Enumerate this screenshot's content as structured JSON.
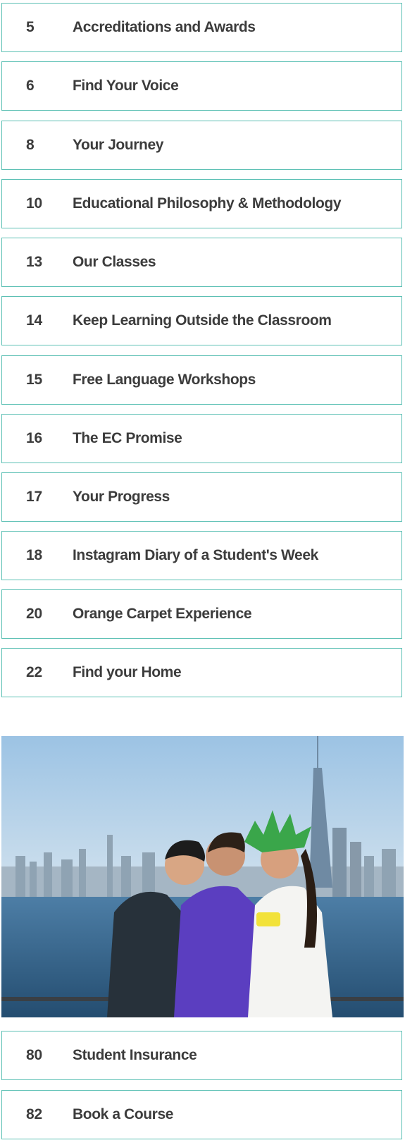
{
  "toc_top": [
    {
      "page": "5",
      "title": "Accreditations and Awards"
    },
    {
      "page": "6",
      "title": "Find Your Voice"
    },
    {
      "page": "8",
      "title": "Your Journey"
    },
    {
      "page": "10",
      "title": "Educational Philosophy & Methodology"
    },
    {
      "page": "13",
      "title": "Our Classes"
    },
    {
      "page": "14",
      "title": "Keep Learning Outside the Classroom"
    },
    {
      "page": "15",
      "title": "Free Language Workshops"
    },
    {
      "page": "16",
      "title": "The EC Promise"
    },
    {
      "page": "17",
      "title": "Your Progress"
    },
    {
      "page": "18",
      "title": "Instagram Diary of a Student's Week"
    },
    {
      "page": "20",
      "title": "Orange Carpet Experience"
    },
    {
      "page": "22",
      "title": "Find your Home"
    }
  ],
  "toc_bottom": [
    {
      "page": "80",
      "title": "Student Insurance"
    },
    {
      "page": "82",
      "title": "Book a Course"
    }
  ],
  "colors": {
    "border": "#5cc0b4",
    "text": "#3c3c3c",
    "sky": "#b8d4ea",
    "water": "#2e5e86"
  }
}
